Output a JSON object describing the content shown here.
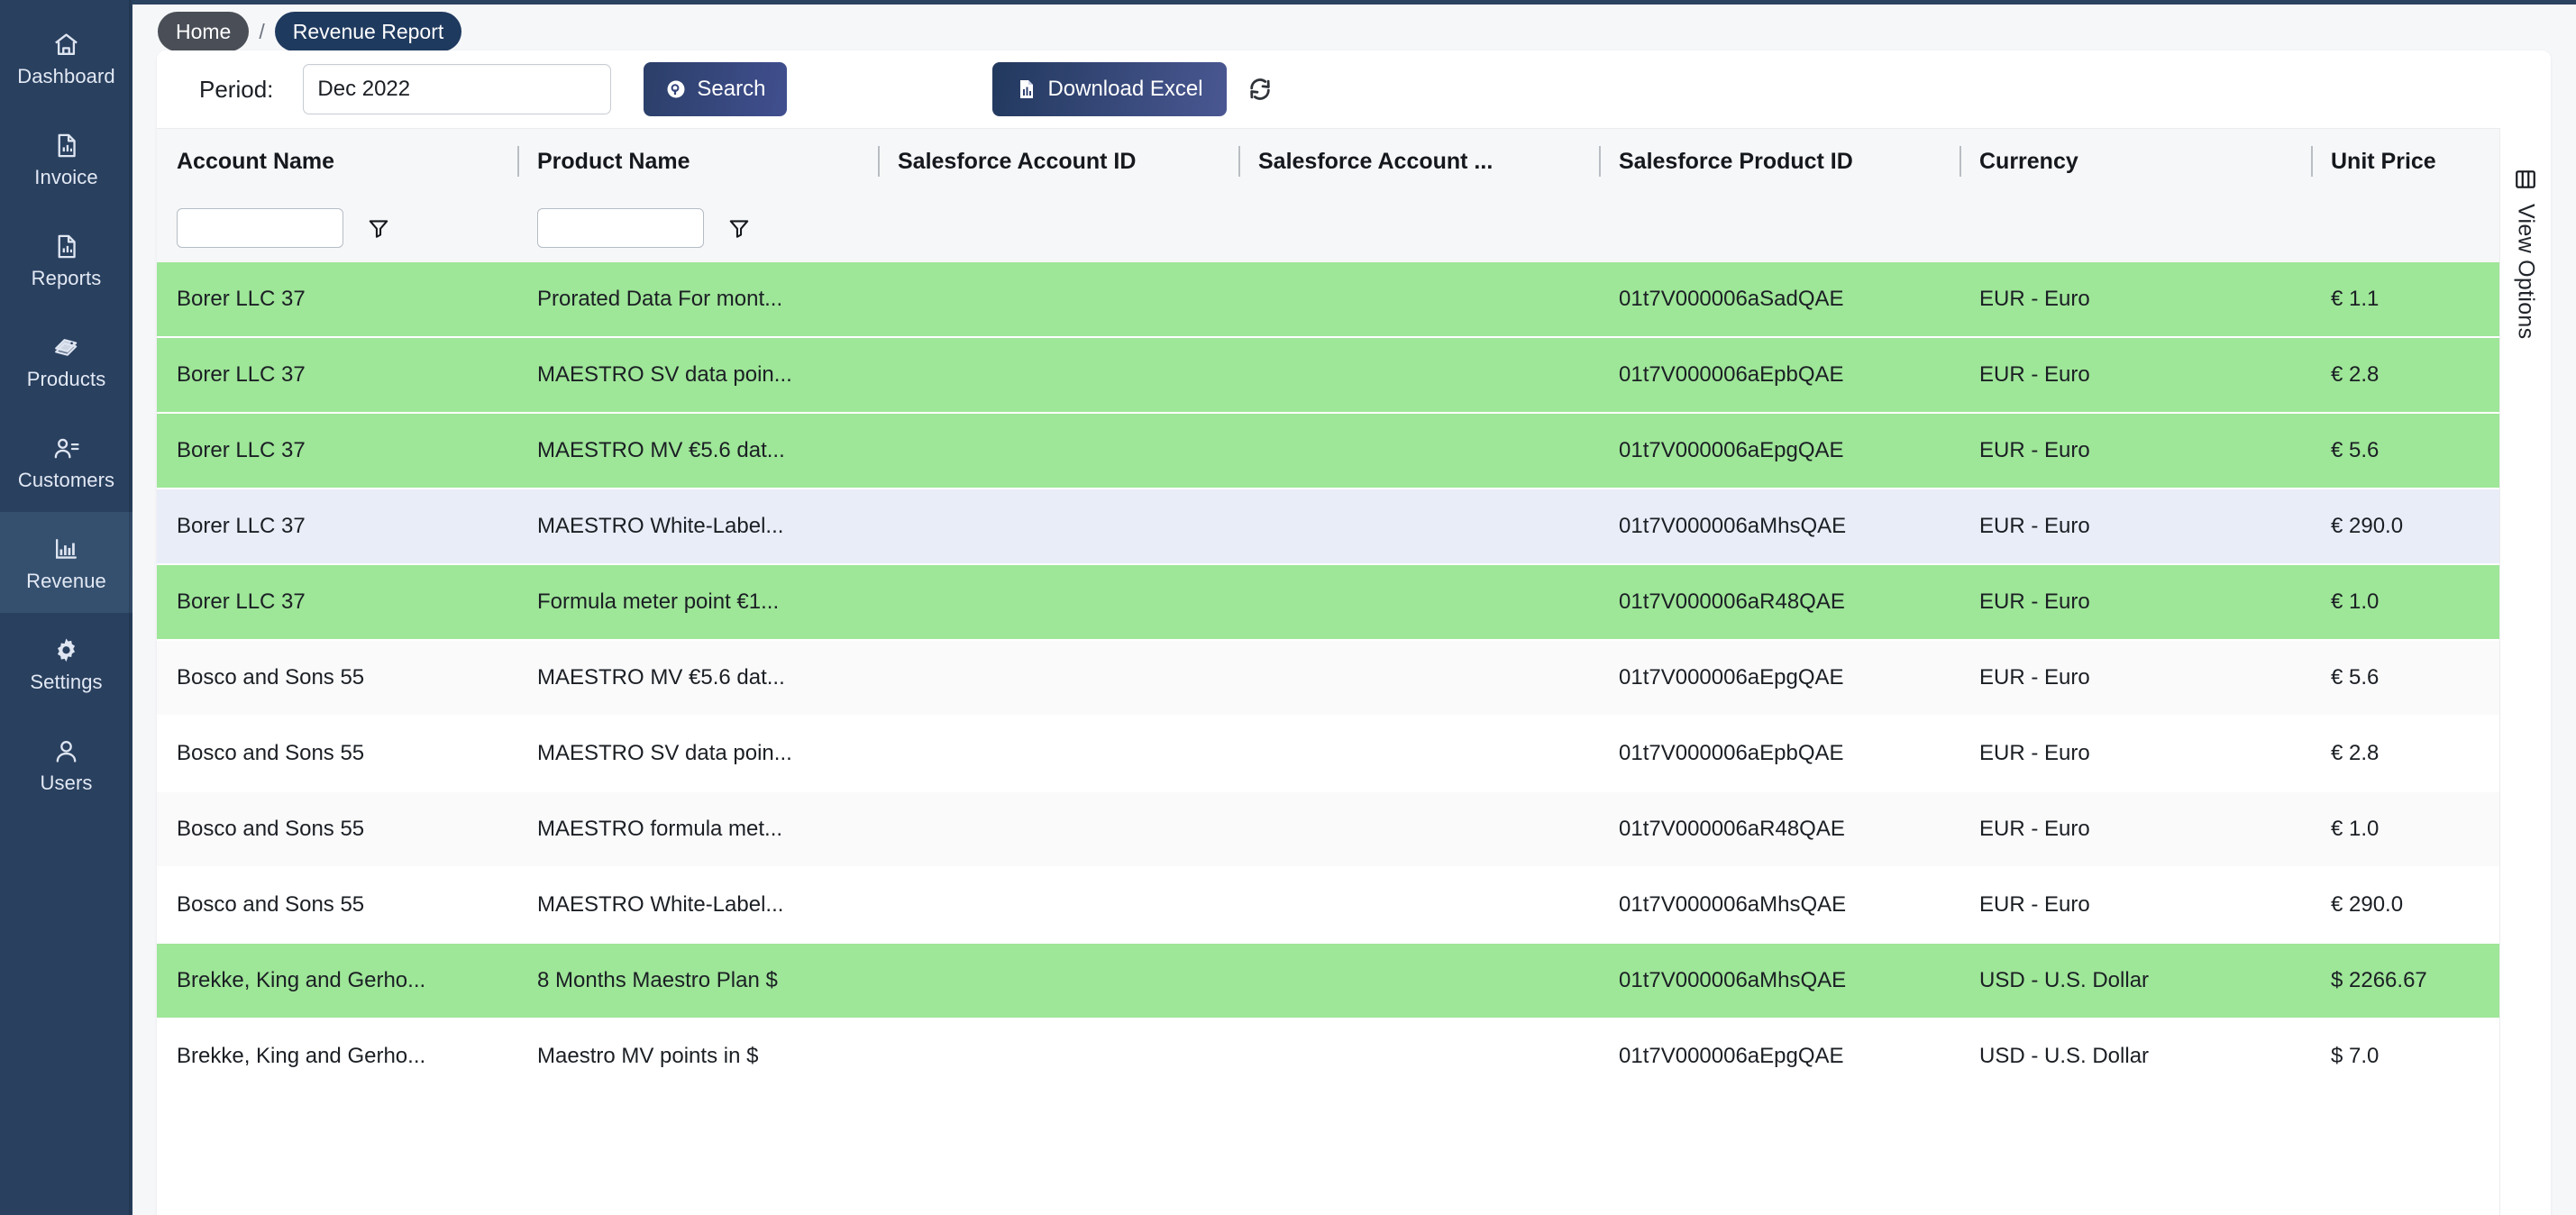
{
  "sidebar": {
    "items": [
      {
        "label": "Dashboard",
        "icon": "home-icon",
        "active": false
      },
      {
        "label": "Invoice",
        "icon": "document-chart-icon",
        "active": false
      },
      {
        "label": "Reports",
        "icon": "document-chart-icon",
        "active": false
      },
      {
        "label": "Products",
        "icon": "tag-icon",
        "active": false
      },
      {
        "label": "Customers",
        "icon": "users-icon",
        "active": false
      },
      {
        "label": "Revenue",
        "icon": "bar-chart-icon",
        "active": true
      },
      {
        "label": "Settings",
        "icon": "gear-icon",
        "active": false
      },
      {
        "label": "Users",
        "icon": "user-icon",
        "active": false
      }
    ]
  },
  "breadcrumb": {
    "home_label": "Home",
    "separator": "/",
    "current_label": "Revenue Report"
  },
  "toolbar": {
    "period_label": "Period:",
    "period_value": "Dec 2022",
    "period_placeholder": "",
    "search_label": "Search",
    "download_label": "Download Excel",
    "refresh_icon": "refresh-icon"
  },
  "view_options": {
    "label": "View Options",
    "icon": "columns-icon"
  },
  "table": {
    "columns": [
      {
        "key": "account",
        "label": "Account Name",
        "filter": true
      },
      {
        "key": "product",
        "label": "Product Name",
        "filter": true
      },
      {
        "key": "sfacct",
        "label": "Salesforce Account ID",
        "filter": false
      },
      {
        "key": "sfacct2",
        "label": "Salesforce Account ...",
        "filter": false
      },
      {
        "key": "sfprod",
        "label": "Salesforce Product ID",
        "filter": false
      },
      {
        "key": "currency",
        "label": "Currency",
        "filter": false
      },
      {
        "key": "price",
        "label": "Unit Price",
        "filter": false
      }
    ],
    "filters": {
      "account_value": "",
      "product_value": ""
    },
    "rows": [
      {
        "hl": "g",
        "account": "Borer LLC 37",
        "product": "Prorated Data For mont...",
        "sfacct": "",
        "sfacct2": "",
        "sfprod": "01t7V000006aSadQAE",
        "currency": "EUR - Euro",
        "price": "€ 1.1"
      },
      {
        "hl": "g",
        "account": "Borer LLC 37",
        "product": "MAESTRO SV data poin...",
        "sfacct": "",
        "sfacct2": "",
        "sfprod": "01t7V000006aEpbQAE",
        "currency": "EUR - Euro",
        "price": "€ 2.8"
      },
      {
        "hl": "g",
        "account": "Borer LLC 37",
        "product": "MAESTRO MV €5.6 dat...",
        "sfacct": "",
        "sfacct2": "",
        "sfprod": "01t7V000006aEpgQAE",
        "currency": "EUR - Euro",
        "price": "€ 5.6"
      },
      {
        "hl": "b",
        "account": "Borer LLC 37",
        "product": "MAESTRO White-Label...",
        "sfacct": "",
        "sfacct2": "",
        "sfprod": "01t7V000006aMhsQAE",
        "currency": "EUR - Euro",
        "price": "€ 290.0"
      },
      {
        "hl": "g",
        "account": "Borer LLC 37",
        "product": "Formula meter point €1...",
        "sfacct": "",
        "sfacct2": "",
        "sfprod": "01t7V000006aR48QAE",
        "currency": "EUR - Euro",
        "price": "€ 1.0"
      },
      {
        "hl": "z",
        "account": "Bosco and Sons 55",
        "product": "MAESTRO MV €5.6 dat...",
        "sfacct": "",
        "sfacct2": "",
        "sfprod": "01t7V000006aEpgQAE",
        "currency": "EUR - Euro",
        "price": "€ 5.6"
      },
      {
        "hl": "w",
        "account": "Bosco and Sons 55",
        "product": "MAESTRO SV data poin...",
        "sfacct": "",
        "sfacct2": "",
        "sfprod": "01t7V000006aEpbQAE",
        "currency": "EUR - Euro",
        "price": "€ 2.8"
      },
      {
        "hl": "z",
        "account": "Bosco and Sons 55",
        "product": "MAESTRO formula met...",
        "sfacct": "",
        "sfacct2": "",
        "sfprod": "01t7V000006aR48QAE",
        "currency": "EUR - Euro",
        "price": "€ 1.0"
      },
      {
        "hl": "w",
        "account": "Bosco and Sons 55",
        "product": "MAESTRO White-Label...",
        "sfacct": "",
        "sfacct2": "",
        "sfprod": "01t7V000006aMhsQAE",
        "currency": "EUR - Euro",
        "price": "€ 290.0"
      },
      {
        "hl": "g",
        "account": "Brekke, King and Gerho...",
        "product": "8 Months Maestro Plan $",
        "sfacct": "",
        "sfacct2": "",
        "sfprod": "01t7V000006aMhsQAE",
        "currency": "USD - U.S. Dollar",
        "price": "$ 2266.67"
      },
      {
        "hl": "w",
        "account": "Brekke, King and Gerho...",
        "product": "Maestro MV points in $",
        "sfacct": "",
        "sfacct2": "",
        "sfprod": "01t7V000006aEpgQAE",
        "currency": "USD - U.S. Dollar",
        "price": "$ 7.0"
      }
    ]
  },
  "colors": {
    "sidebar_bg": "#29405f",
    "sidebar_active": "#35506f",
    "accent_blue": "#1f3a5f",
    "row_highlight_green": "#9ee698",
    "row_highlight_blue": "#e8edf8"
  }
}
